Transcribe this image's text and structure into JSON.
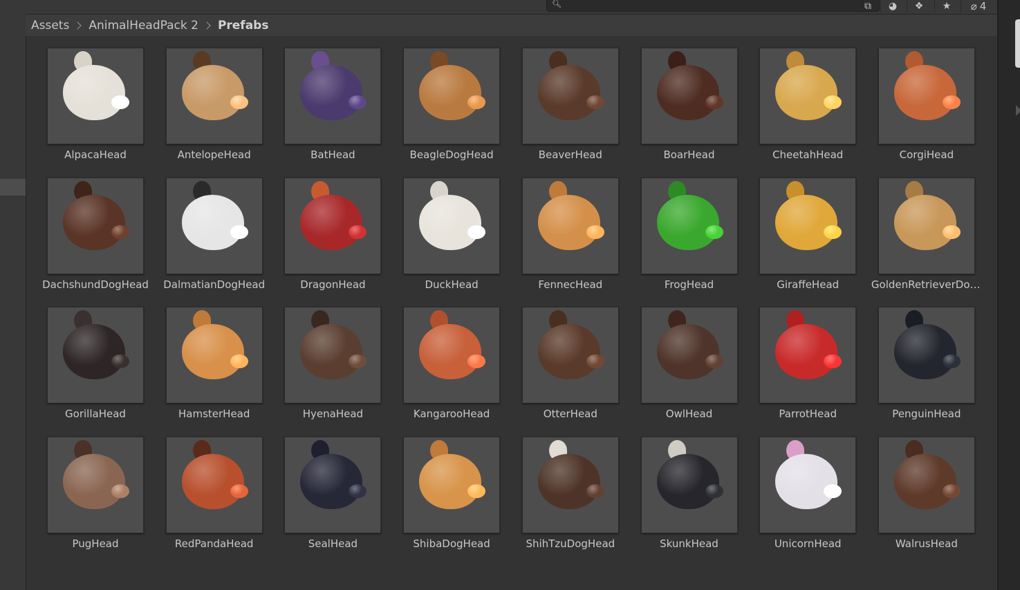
{
  "breadcrumb": [
    "Assets",
    "AnimalHeadPack 2",
    "Prefabs"
  ],
  "toolbar": {
    "search_value": "",
    "hidden_count": "4"
  },
  "assets": [
    {
      "label": "AlpacaHead",
      "color": "#e6e1d8",
      "ear": "#d8d2c8"
    },
    {
      "label": "AntelopeHead",
      "color": "#c89a68",
      "ear": "#5a3a22"
    },
    {
      "label": "BatHead",
      "color": "#4b3a6e",
      "ear": "#6a4f90"
    },
    {
      "label": "BeagleDogHead",
      "color": "#b97a3f",
      "ear": "#7a4a24"
    },
    {
      "label": "BeaverHead",
      "color": "#5a3a2a",
      "ear": "#4a2e20"
    },
    {
      "label": "BoarHead",
      "color": "#4e2c22",
      "ear": "#3a2018"
    },
    {
      "label": "CheetahHead",
      "color": "#d8a84e",
      "ear": "#c08c3a"
    },
    {
      "label": "CorgiHead",
      "color": "#c8683a",
      "ear": "#b25a30"
    },
    {
      "label": "DachshundDogHead",
      "color": "#5a3426",
      "ear": "#3e241a"
    },
    {
      "label": "DalmatianDogHead",
      "color": "#e6e6e6",
      "ear": "#2a2a2a"
    },
    {
      "label": "DragonHead",
      "color": "#a8282a",
      "ear": "#c85a30"
    },
    {
      "label": "DuckHead",
      "color": "#e8e4dc",
      "ear": "#d8d4cc"
    },
    {
      "label": "FennecHead",
      "color": "#d4904a",
      "ear": "#c07a3a"
    },
    {
      "label": "FrogHead",
      "color": "#3aa82e",
      "ear": "#2e8a24"
    },
    {
      "label": "GiraffeHead",
      "color": "#e0a83a",
      "ear": "#c8902a"
    },
    {
      "label": "GoldenRetrieverDogHead",
      "color": "#c8985a",
      "ear": "#a87a44"
    },
    {
      "label": "GorillaHead",
      "color": "#2e2626",
      "ear": "#3a3030"
    },
    {
      "label": "HamsterHead",
      "color": "#d8904a",
      "ear": "#c07a3a"
    },
    {
      "label": "HyenaHead",
      "color": "#5a3e30",
      "ear": "#3a2820"
    },
    {
      "label": "KangarooHead",
      "color": "#c8603a",
      "ear": "#b0502e"
    },
    {
      "label": "OtterHead",
      "color": "#5a3a2a",
      "ear": "#4a2e20"
    },
    {
      "label": "OwlHead",
      "color": "#4e342a",
      "ear": "#3e261e"
    },
    {
      "label": "ParrotHead",
      "color": "#c82a2a",
      "ear": "#b02020"
    },
    {
      "label": "PenguinHead",
      "color": "#23262e",
      "ear": "#1a1d24"
    },
    {
      "label": "PugHead",
      "color": "#8a6652",
      "ear": "#4a3228"
    },
    {
      "label": "RedPandaHead",
      "color": "#b8502e",
      "ear": "#5a2a1a"
    },
    {
      "label": "SealHead",
      "color": "#262838",
      "ear": "#1e2030"
    },
    {
      "label": "ShibaDogHead",
      "color": "#d8944a",
      "ear": "#c07a3a"
    },
    {
      "label": "ShihTzuDogHead",
      "color": "#4e3428",
      "ear": "#e0dcd4"
    },
    {
      "label": "SkunkHead",
      "color": "#26262c",
      "ear": "#d0ccc4"
    },
    {
      "label": "UnicornHead",
      "color": "#e4e0e8",
      "ear": "#d8a0c8"
    },
    {
      "label": "WalrusHead",
      "color": "#5e3a2a",
      "ear": "#4a2c20"
    }
  ]
}
